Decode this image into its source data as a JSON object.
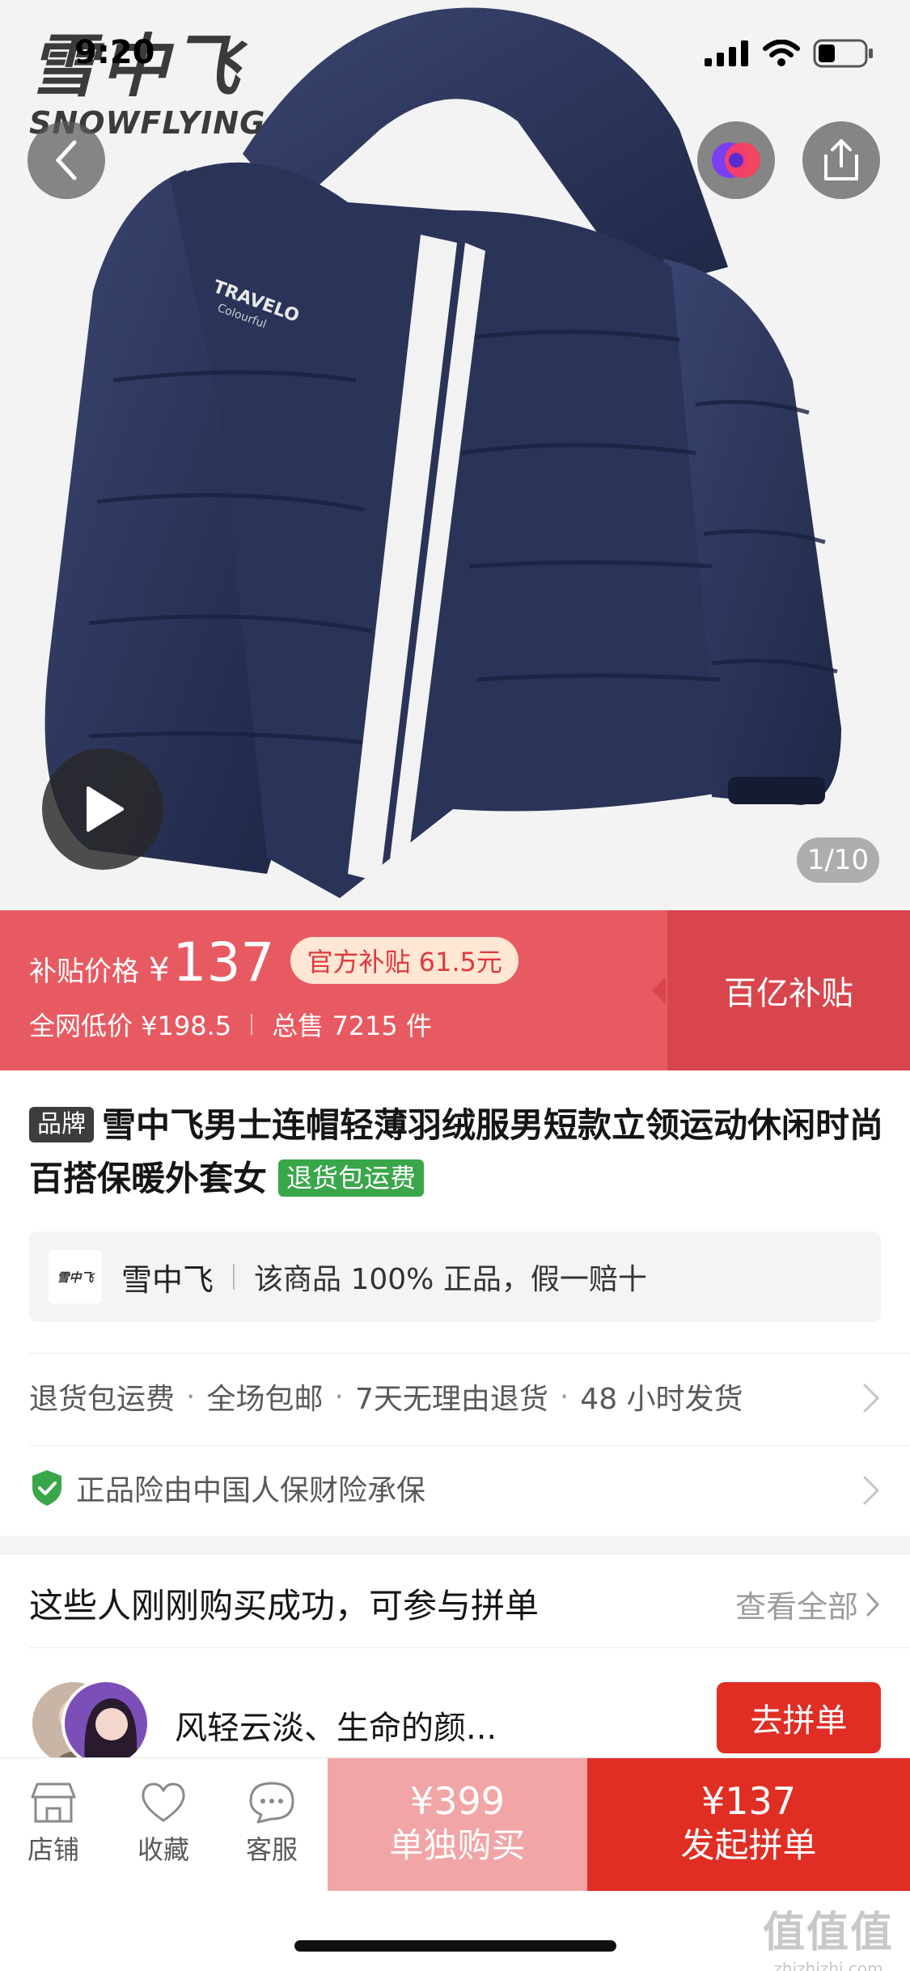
{
  "status_bar": {
    "time": "9:20"
  },
  "brand_logo": {
    "cn": "雪中飞",
    "en": "SNOWFLYING"
  },
  "jacket_print": {
    "line1": "TRAVELO",
    "line2": "Colourful"
  },
  "gallery": {
    "indicator": "1/10"
  },
  "price_banner": {
    "label": "补贴价格",
    "currency": "¥",
    "price": "137",
    "subsidy": "官方补贴 61.5元",
    "lowest": "全网低价 ¥198.5",
    "sales": "总售 7215 件",
    "program": "百亿补贴"
  },
  "title": {
    "brand_tag": "品牌",
    "text": "雪中飞男士连帽轻薄羽绒服男短款立领运动休闲时尚百搭保暖外套女",
    "return_tag": "退货包运费"
  },
  "store": {
    "logo_text": "雪中飞",
    "name": "雪中飞",
    "guarantee": "该商品 100% 正品，假一赔十"
  },
  "services": [
    "退货包运费",
    "全场包邮",
    "7天无理由退货",
    "48 小时发货"
  ],
  "insurance": {
    "text": "正品险由中国人保财险承保"
  },
  "group_buy": {
    "heading": "这些人刚刚购买成功，可参与拼单",
    "more": "查看全部",
    "user": "风轻云淡、生命的颜...",
    "join": "去拼单"
  },
  "bottom_bar": {
    "store": "店铺",
    "favorite": "收藏",
    "service": "客服",
    "solo_price": "¥399",
    "solo_label": "单独购买",
    "group_price": "¥137",
    "group_label": "发起拼单"
  },
  "watermark": {
    "main": "值值值",
    "sub": "zhizhizhi.com"
  },
  "colors": {
    "accent": "#e02e24",
    "banner": "#e85a61",
    "banner_dark": "#d8454c",
    "green": "#3aa64a"
  }
}
